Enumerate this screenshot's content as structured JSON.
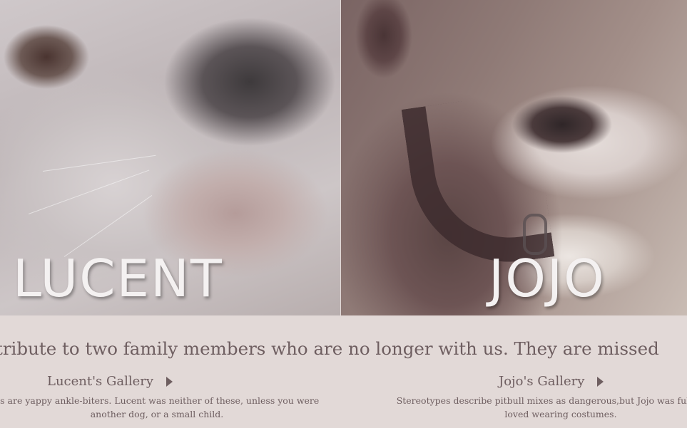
{
  "hero": {
    "left_title": "LUCENT",
    "right_title": "JOJO"
  },
  "main": {
    "tagline": "tribute to two family members who are no longer with us. They are missed",
    "galleries": [
      {
        "link_label": "Lucent's Gallery",
        "blurb_line1": "as are yappy ankle-biters. Lucent was neither of these, unless you were",
        "blurb_line2": "another dog, or a small child."
      },
      {
        "link_label": "Jojo's Gallery",
        "blurb_line1": "Stereotypes describe pitbull mixes as dangerous,but Jojo was full of love",
        "blurb_line2": "loved wearing costumes."
      }
    ]
  },
  "icons": {
    "gallery_link_arrow": "caret-right-icon"
  },
  "colors": {
    "background": "#e2d9d7",
    "text": "#6e5e60",
    "hero_title": "#f4f1f1"
  }
}
